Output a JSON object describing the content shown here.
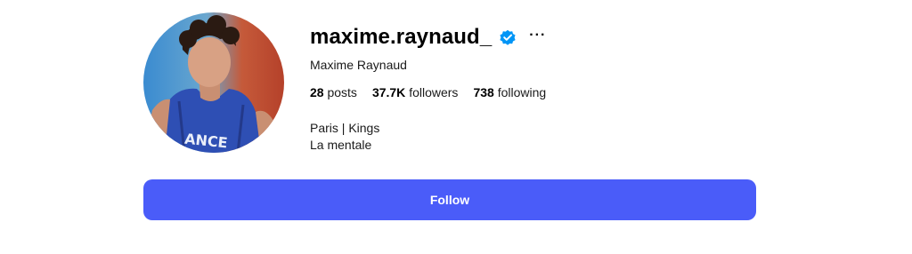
{
  "profile": {
    "username": "maxime.raynaud_",
    "verified": true,
    "full_name": "Maxime Raynaud",
    "stats": {
      "posts_count": "28",
      "posts_label": "posts",
      "followers_count": "37.7K",
      "followers_label": "followers",
      "following_count": "738",
      "following_label": "following"
    },
    "bio_lines": [
      "Paris | Kings",
      "La mentale"
    ],
    "more_label": "···"
  },
  "actions": {
    "follow_label": "Follow"
  },
  "colors": {
    "accent": "#4a5cf9",
    "verified_badge": "#0095f6"
  },
  "icons": {
    "verified": "verified-badge-icon",
    "more": "more-options-icon"
  }
}
